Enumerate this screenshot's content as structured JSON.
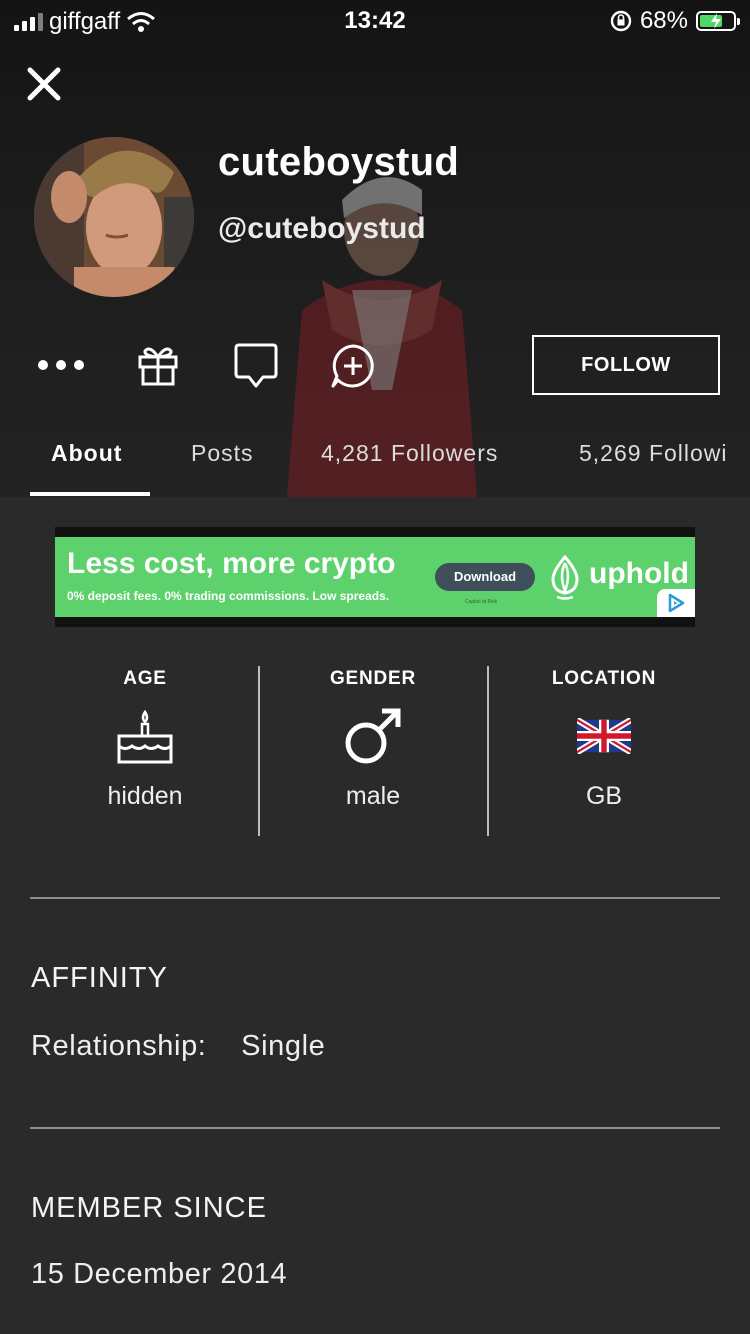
{
  "status_bar": {
    "carrier": "giffgaff",
    "time": "13:42",
    "battery": "68%"
  },
  "profile": {
    "display_name": "cuteboystud",
    "handle": "@cuteboystud"
  },
  "actions": {
    "follow_label": "FOLLOW"
  },
  "tabs": [
    {
      "label": "About"
    },
    {
      "label": "Posts"
    },
    {
      "label": "4,281 Followers"
    },
    {
      "label": "5,269 Followi"
    }
  ],
  "ad": {
    "headline": "Less cost, more crypto",
    "subline": "0% deposit fees. 0% trading commissions. Low spreads.",
    "button": "Download",
    "caption": "Capital at Risk",
    "brand": "uphold"
  },
  "stats": {
    "age": {
      "label": "AGE",
      "value": "hidden"
    },
    "gender": {
      "label": "GENDER",
      "value": "male"
    },
    "location": {
      "label": "LOCATION",
      "value": "GB"
    }
  },
  "affinity": {
    "title": "AFFINITY",
    "relationship_label": "Relationship:",
    "relationship_value": "Single"
  },
  "member_since": {
    "title": "MEMBER SINCE",
    "date": "15 December 2014"
  }
}
